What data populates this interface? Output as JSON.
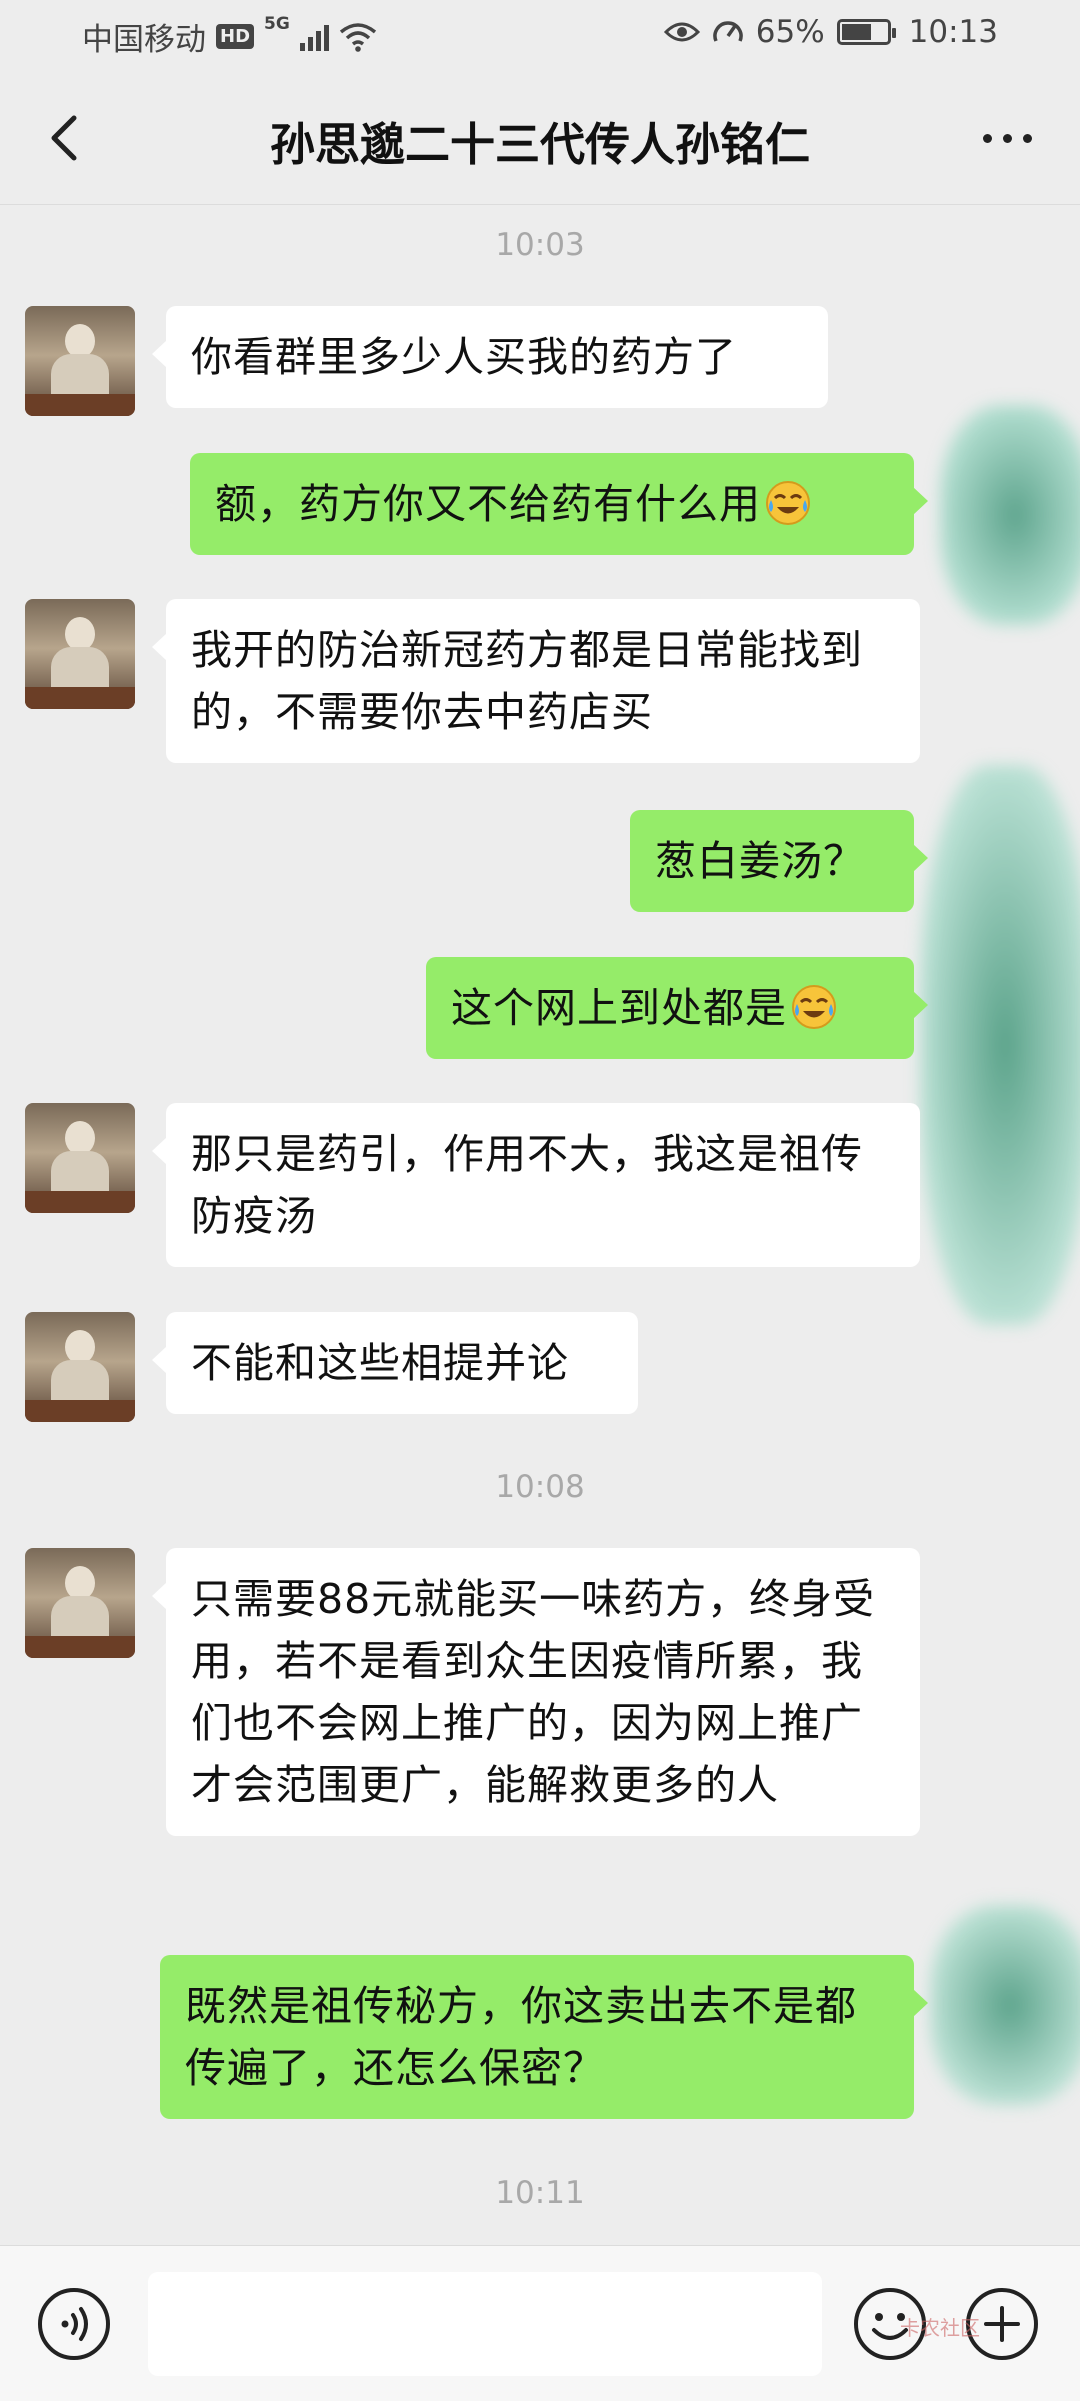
{
  "status_bar": {
    "carrier": "中国移动",
    "hd": "HD",
    "network": "5G",
    "battery": "65%",
    "battery_level": 0.65,
    "time": "10:13"
  },
  "header": {
    "title": "孙思邈二十三代传人孙铭仁"
  },
  "chat": {
    "timestamps": [
      "10:03",
      "10:08",
      "10:11"
    ],
    "messages": [
      {
        "side": "in",
        "text": "你看群里多少人买我的药方了"
      },
      {
        "side": "out",
        "text": "额，药方你又不给药有什么用",
        "emoji": "crying-laughing-emoji"
      },
      {
        "side": "in",
        "text": "我开的防治新冠药方都是日常能找到的，不需要你去中药店买"
      },
      {
        "side": "out",
        "text": "葱白姜汤？"
      },
      {
        "side": "out",
        "text": "这个网上到处都是",
        "emoji": "crying-laughing-emoji"
      },
      {
        "side": "in",
        "text": "那只是药引，作用不大，我这是祖传防疫汤"
      },
      {
        "side": "in",
        "text": "不能和这些相提并论"
      },
      {
        "side": "in",
        "text": "只需要88元就能买一味药方，终身受用，若不是看到众生因疫情所累，我们也不会网上推广的，因为网上推广才会范围更广，能解救更多的人"
      },
      {
        "side": "out",
        "text": "既然是祖传秘方，你这卖出去不是都传遍了，还怎么保密？"
      }
    ]
  },
  "input_bar": {
    "placeholder": "",
    "watermark": "卡农社区"
  },
  "colors": {
    "background": "#ededed",
    "incoming_bubble": "#ffffff",
    "outgoing_bubble": "#95ec69",
    "timestamp": "#a8a8a8"
  }
}
